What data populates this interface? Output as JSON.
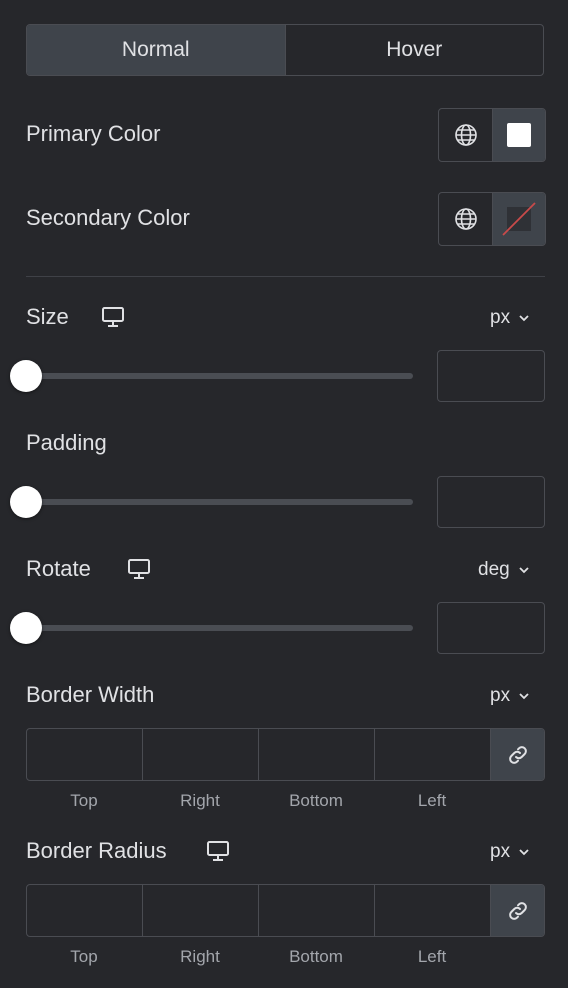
{
  "tabs": [
    {
      "label": "Normal",
      "active": true
    },
    {
      "label": "Hover",
      "active": false
    }
  ],
  "primary_color": {
    "label": "Primary Color",
    "globe_icon": "globe-icon",
    "swatch": "#ffffff"
  },
  "secondary_color": {
    "label": "Secondary Color",
    "globe_icon": "globe-icon",
    "swatch": "none"
  },
  "size": {
    "label": "Size",
    "device_icon": "desktop-icon",
    "unit": "px",
    "value": ""
  },
  "padding": {
    "label": "Padding",
    "value": ""
  },
  "rotate": {
    "label": "Rotate",
    "device_icon": "desktop-icon",
    "unit": "deg",
    "value": ""
  },
  "border_width": {
    "label": "Border Width",
    "unit": "px",
    "sides": [
      "Top",
      "Right",
      "Bottom",
      "Left"
    ],
    "link_icon": "link-icon"
  },
  "border_radius": {
    "label": "Border Radius",
    "device_icon": "desktop-icon",
    "unit": "px",
    "sides": [
      "Top",
      "Right",
      "Bottom",
      "Left"
    ],
    "link_icon": "link-icon"
  },
  "colors": {
    "bg": "#26272b",
    "active_tab": "#3f444b",
    "border": "#4a4c52",
    "strike": "#c94a4a"
  }
}
